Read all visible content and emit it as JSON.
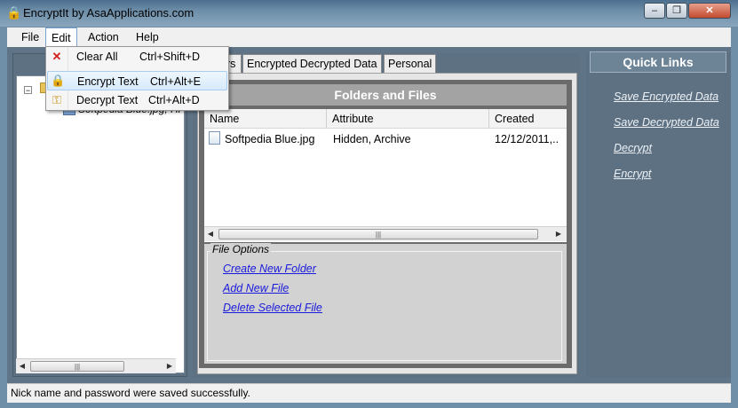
{
  "window": {
    "title": "EncryptIt by AsaApplications.com",
    "minimize_glyph": "–",
    "restore_glyph": "❐",
    "close_glyph": "✕"
  },
  "menu": {
    "file": "File",
    "edit": "Edit",
    "action": "Action",
    "help": "Help"
  },
  "edit_menu": {
    "items": [
      {
        "label": "Clear All",
        "shortcut": "Ctrl+Shift+D",
        "icon": "red-x-icon"
      },
      {
        "label": "Encrypt Text",
        "shortcut": "Ctrl+Alt+E",
        "icon": "lock-icon"
      },
      {
        "label": "Decrypt Text",
        "shortcut": "Ctrl+Alt+D",
        "icon": "key-icon"
      }
    ]
  },
  "tree": {
    "item_label": "Softpedia Blue.jpg, Hi"
  },
  "tabs": {
    "first_partial": "rs",
    "encrypted_decrypted": "Encrypted Decrypted Data",
    "personal": "Personal"
  },
  "files": {
    "header": "Folders and Files",
    "columns": [
      "Name",
      "Attribute",
      "Created"
    ],
    "rows": [
      {
        "name": "Softpedia Blue.jpg",
        "attribute": "Hidden, Archive",
        "created": "12/12/2011,.."
      }
    ]
  },
  "file_options": {
    "label": "File Options",
    "links": [
      "Create New Folder",
      "Add New File",
      "Delete Selected File"
    ]
  },
  "quick_links": {
    "header": "Quick Links",
    "links": [
      "Save Encrypted Data",
      "Save Decrypted Data",
      "Decrypt",
      "Encrypt"
    ]
  },
  "status": {
    "message": "Nick name and password were saved successfully."
  },
  "colors": {
    "link_blue": "#1a1adc",
    "panel": "#5d7183",
    "selection": "#d7eafb"
  }
}
